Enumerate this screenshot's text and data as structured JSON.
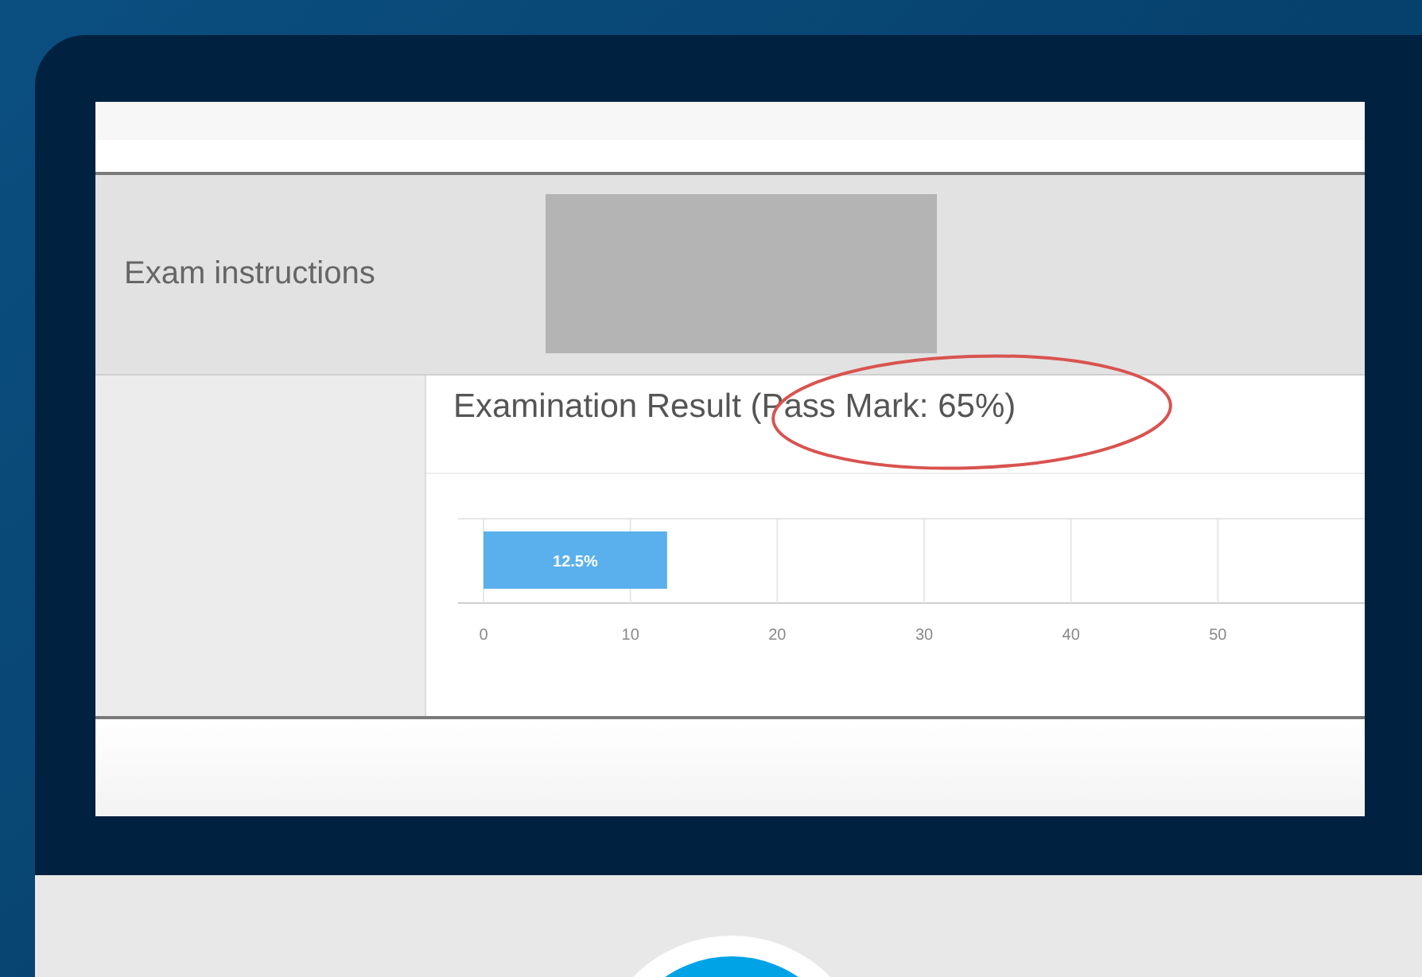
{
  "screen": {
    "header": {
      "label": "Exam instructions"
    },
    "result": {
      "title": "Examination Result (Pass Mark: 65%)",
      "chart_data": {
        "type": "bar",
        "orientation": "horizontal",
        "values": [
          12.5
        ],
        "value_labels": [
          "12.5%"
        ],
        "xlim": [
          0,
          60
        ],
        "xticks": [
          0,
          10,
          20,
          30,
          40,
          50
        ],
        "color": "#5ab0ec",
        "grid": true
      }
    }
  }
}
